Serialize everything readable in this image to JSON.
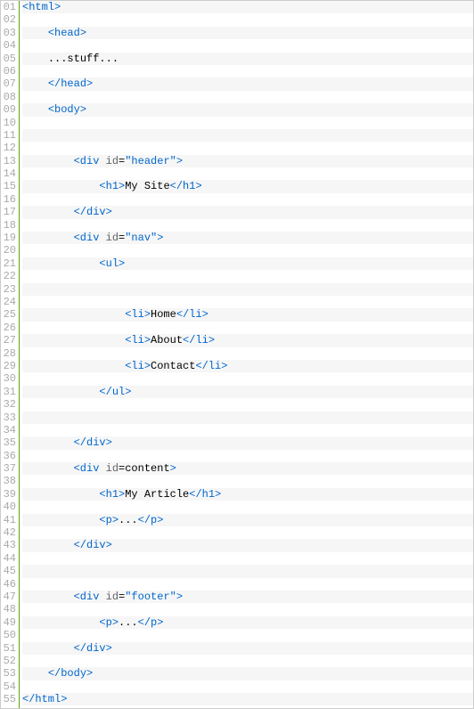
{
  "lines": [
    {
      "n": "01",
      "indent": 0,
      "segs": [
        {
          "c": "tag",
          "t": "<html>"
        }
      ]
    },
    {
      "n": "02",
      "indent": 0,
      "segs": []
    },
    {
      "n": "03",
      "indent": 1,
      "segs": [
        {
          "c": "tag",
          "t": "<head>"
        }
      ]
    },
    {
      "n": "04",
      "indent": 0,
      "segs": []
    },
    {
      "n": "05",
      "indent": 1,
      "segs": [
        {
          "c": "txt",
          "t": "...stuff..."
        }
      ]
    },
    {
      "n": "06",
      "indent": 0,
      "segs": []
    },
    {
      "n": "07",
      "indent": 1,
      "segs": [
        {
          "c": "tag",
          "t": "</head>"
        }
      ]
    },
    {
      "n": "08",
      "indent": 0,
      "segs": []
    },
    {
      "n": "09",
      "indent": 1,
      "segs": [
        {
          "c": "tag",
          "t": "<body>"
        }
      ]
    },
    {
      "n": "10",
      "indent": 0,
      "segs": []
    },
    {
      "n": "11",
      "indent": 0,
      "segs": []
    },
    {
      "n": "12",
      "indent": 0,
      "segs": []
    },
    {
      "n": "13",
      "indent": 2,
      "segs": [
        {
          "c": "tag",
          "t": "<div"
        },
        {
          "c": "txt",
          "t": " "
        },
        {
          "c": "attr",
          "t": "id"
        },
        {
          "c": "txt",
          "t": "="
        },
        {
          "c": "val",
          "t": "\"header\""
        },
        {
          "c": "tag",
          "t": ">"
        }
      ]
    },
    {
      "n": "14",
      "indent": 0,
      "segs": []
    },
    {
      "n": "15",
      "indent": 3,
      "segs": [
        {
          "c": "tag",
          "t": "<h1>"
        },
        {
          "c": "txt",
          "t": "My Site"
        },
        {
          "c": "tag",
          "t": "</h1>"
        }
      ]
    },
    {
      "n": "16",
      "indent": 0,
      "segs": []
    },
    {
      "n": "17",
      "indent": 2,
      "segs": [
        {
          "c": "tag",
          "t": "</div>"
        }
      ]
    },
    {
      "n": "18",
      "indent": 0,
      "segs": []
    },
    {
      "n": "19",
      "indent": 2,
      "segs": [
        {
          "c": "tag",
          "t": "<div"
        },
        {
          "c": "txt",
          "t": " "
        },
        {
          "c": "attr",
          "t": "id"
        },
        {
          "c": "txt",
          "t": "="
        },
        {
          "c": "val",
          "t": "\"nav\""
        },
        {
          "c": "tag",
          "t": ">"
        }
      ]
    },
    {
      "n": "20",
      "indent": 0,
      "segs": []
    },
    {
      "n": "21",
      "indent": 3,
      "segs": [
        {
          "c": "tag",
          "t": "<ul>"
        }
      ]
    },
    {
      "n": "22",
      "indent": 0,
      "segs": []
    },
    {
      "n": "23",
      "indent": 0,
      "segs": []
    },
    {
      "n": "24",
      "indent": 0,
      "segs": []
    },
    {
      "n": "25",
      "indent": 4,
      "segs": [
        {
          "c": "tag",
          "t": "<li>"
        },
        {
          "c": "txt",
          "t": "Home"
        },
        {
          "c": "tag",
          "t": "</li>"
        }
      ]
    },
    {
      "n": "26",
      "indent": 0,
      "segs": []
    },
    {
      "n": "27",
      "indent": 4,
      "segs": [
        {
          "c": "tag",
          "t": "<li>"
        },
        {
          "c": "txt",
          "t": "About"
        },
        {
          "c": "tag",
          "t": "</li>"
        }
      ]
    },
    {
      "n": "28",
      "indent": 0,
      "segs": []
    },
    {
      "n": "29",
      "indent": 4,
      "segs": [
        {
          "c": "tag",
          "t": "<li>"
        },
        {
          "c": "txt",
          "t": "Contact"
        },
        {
          "c": "tag",
          "t": "</li>"
        }
      ]
    },
    {
      "n": "30",
      "indent": 0,
      "segs": []
    },
    {
      "n": "31",
      "indent": 3,
      "segs": [
        {
          "c": "tag",
          "t": "</ul>"
        }
      ]
    },
    {
      "n": "32",
      "indent": 0,
      "segs": []
    },
    {
      "n": "33",
      "indent": 0,
      "segs": []
    },
    {
      "n": "34",
      "indent": 0,
      "segs": []
    },
    {
      "n": "35",
      "indent": 2,
      "segs": [
        {
          "c": "tag",
          "t": "</div>"
        }
      ]
    },
    {
      "n": "36",
      "indent": 0,
      "segs": []
    },
    {
      "n": "37",
      "indent": 2,
      "segs": [
        {
          "c": "tag",
          "t": "<div"
        },
        {
          "c": "txt",
          "t": " "
        },
        {
          "c": "attr",
          "t": "id"
        },
        {
          "c": "txt",
          "t": "="
        },
        {
          "c": "txt",
          "t": "content"
        },
        {
          "c": "tag",
          "t": ">"
        }
      ]
    },
    {
      "n": "38",
      "indent": 0,
      "segs": []
    },
    {
      "n": "39",
      "indent": 3,
      "segs": [
        {
          "c": "tag",
          "t": "<h1>"
        },
        {
          "c": "txt",
          "t": "My Article"
        },
        {
          "c": "tag",
          "t": "</h1>"
        }
      ]
    },
    {
      "n": "40",
      "indent": 0,
      "segs": []
    },
    {
      "n": "41",
      "indent": 3,
      "segs": [
        {
          "c": "tag",
          "t": "<p>"
        },
        {
          "c": "txt",
          "t": "..."
        },
        {
          "c": "tag",
          "t": "</p>"
        }
      ]
    },
    {
      "n": "42",
      "indent": 0,
      "segs": []
    },
    {
      "n": "43",
      "indent": 2,
      "segs": [
        {
          "c": "tag",
          "t": "</div>"
        }
      ]
    },
    {
      "n": "44",
      "indent": 0,
      "segs": []
    },
    {
      "n": "45",
      "indent": 0,
      "segs": []
    },
    {
      "n": "46",
      "indent": 0,
      "segs": []
    },
    {
      "n": "47",
      "indent": 2,
      "segs": [
        {
          "c": "tag",
          "t": "<div"
        },
        {
          "c": "txt",
          "t": " "
        },
        {
          "c": "attr",
          "t": "id"
        },
        {
          "c": "txt",
          "t": "="
        },
        {
          "c": "val",
          "t": "\"footer\""
        },
        {
          "c": "tag",
          "t": ">"
        }
      ]
    },
    {
      "n": "48",
      "indent": 0,
      "segs": []
    },
    {
      "n": "49",
      "indent": 3,
      "segs": [
        {
          "c": "tag",
          "t": "<p>"
        },
        {
          "c": "txt",
          "t": "..."
        },
        {
          "c": "tag",
          "t": "</p>"
        }
      ]
    },
    {
      "n": "50",
      "indent": 0,
      "segs": []
    },
    {
      "n": "51",
      "indent": 2,
      "segs": [
        {
          "c": "tag",
          "t": "</div>"
        }
      ]
    },
    {
      "n": "52",
      "indent": 0,
      "segs": []
    },
    {
      "n": "53",
      "indent": 1,
      "segs": [
        {
          "c": "tag",
          "t": "</body>"
        }
      ]
    },
    {
      "n": "54",
      "indent": 0,
      "segs": []
    },
    {
      "n": "55",
      "indent": 0,
      "segs": [
        {
          "c": "tag",
          "t": "</html>"
        }
      ]
    }
  ],
  "indent_unit": "    "
}
